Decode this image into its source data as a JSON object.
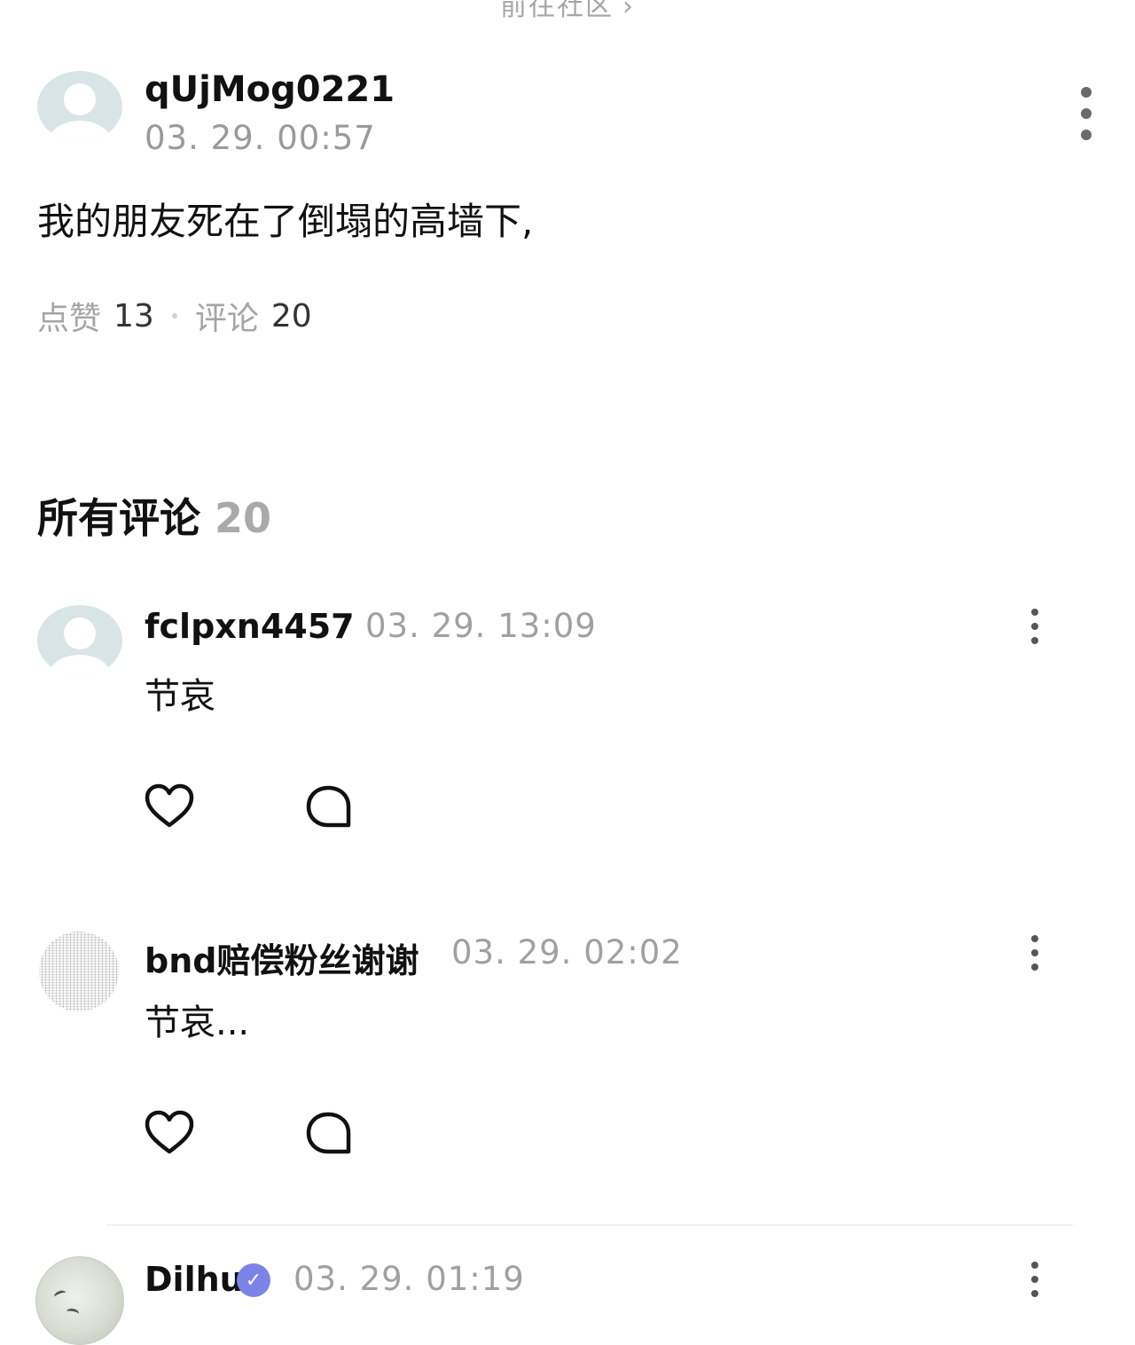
{
  "top_link": {
    "label": "前往社区",
    "chevron": "›"
  },
  "post": {
    "username": "qUjMog0221",
    "timestamp": "03. 29. 00:57",
    "text": "我的朋友死在了倒塌的高墙下,",
    "likes_label": "点赞",
    "likes_count": "13",
    "comments_label": "评论",
    "comments_count": "20"
  },
  "comments_section": {
    "title": "所有评论",
    "count": "20"
  },
  "comments": [
    {
      "username": "fclpxn4457",
      "timestamp": "03. 29. 13:09",
      "text": "节哀"
    },
    {
      "username": "bnd赔偿粉丝谢谢",
      "timestamp": "03. 29. 02:02",
      "text": "节哀..."
    },
    {
      "username": "Dilhu",
      "timestamp": "03. 29. 01:19",
      "verified_icon": "verified-badge-icon"
    }
  ],
  "colors": {
    "text": "#111111",
    "muted": "#9a9a9a",
    "verified": "#7b84e6",
    "avatar_placeholder": "#d9e4e7"
  }
}
